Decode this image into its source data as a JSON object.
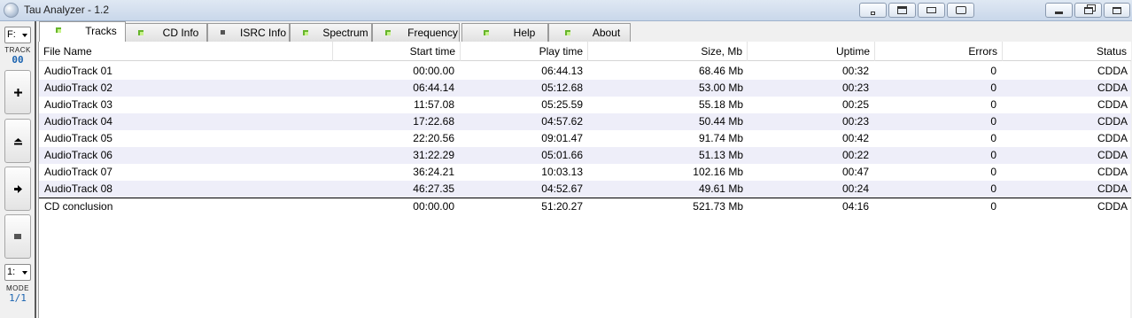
{
  "window": {
    "title": "Tau Analyzer - 1.2"
  },
  "left_panel": {
    "drive_value": "F:",
    "track_label": "TRACK",
    "track_number": "00",
    "mode_select_value": "1:",
    "mode_label": "MODE",
    "mode_value": "1/1"
  },
  "tabs": [
    {
      "label": "Tracks",
      "active": true,
      "led": "green"
    },
    {
      "label": "CD Info",
      "active": false,
      "led": "green"
    },
    {
      "label": "ISRC Info",
      "active": false,
      "led": "gray"
    },
    {
      "label": "Spectrum",
      "active": false,
      "led": "green"
    },
    {
      "label": "Frequency",
      "active": false,
      "led": "green"
    },
    {
      "label": "Help",
      "active": false,
      "led": "green"
    },
    {
      "label": "About",
      "active": false,
      "led": "green"
    }
  ],
  "table": {
    "columns": [
      "File Name",
      "Start time",
      "Play time",
      "Size, Mb",
      "Uptime",
      "Errors",
      "Status"
    ],
    "rows": [
      [
        "AudioTrack 01",
        "00:00.00",
        "06:44.13",
        "68.46 Mb",
        "00:32",
        "0",
        "CDDA"
      ],
      [
        "AudioTrack 02",
        "06:44.14",
        "05:12.68",
        "53.00 Mb",
        "00:23",
        "0",
        "CDDA"
      ],
      [
        "AudioTrack 03",
        "11:57.08",
        "05:25.59",
        "55.18 Mb",
        "00:25",
        "0",
        "CDDA"
      ],
      [
        "AudioTrack 04",
        "17:22.68",
        "04:57.62",
        "50.44 Mb",
        "00:23",
        "0",
        "CDDA"
      ],
      [
        "AudioTrack 05",
        "22:20.56",
        "09:01.47",
        "91.74 Mb",
        "00:42",
        "0",
        "CDDA"
      ],
      [
        "AudioTrack 06",
        "31:22.29",
        "05:01.66",
        "51.13 Mb",
        "00:22",
        "0",
        "CDDA"
      ],
      [
        "AudioTrack 07",
        "36:24.21",
        "10:03.13",
        "102.16 Mb",
        "00:47",
        "0",
        "CDDA"
      ],
      [
        "AudioTrack 08",
        "46:27.35",
        "04:52.67",
        "49.61 Mb",
        "00:24",
        "0",
        "CDDA"
      ]
    ],
    "summary": [
      "CD conclusion",
      "00:00.00",
      "51:20.27",
      "521.73 Mb",
      "04:16",
      "0",
      "CDDA"
    ]
  },
  "colors": {
    "alt_row": "#eeeef9",
    "track_number": "#1a63b0",
    "led_green": "#67b52b"
  }
}
